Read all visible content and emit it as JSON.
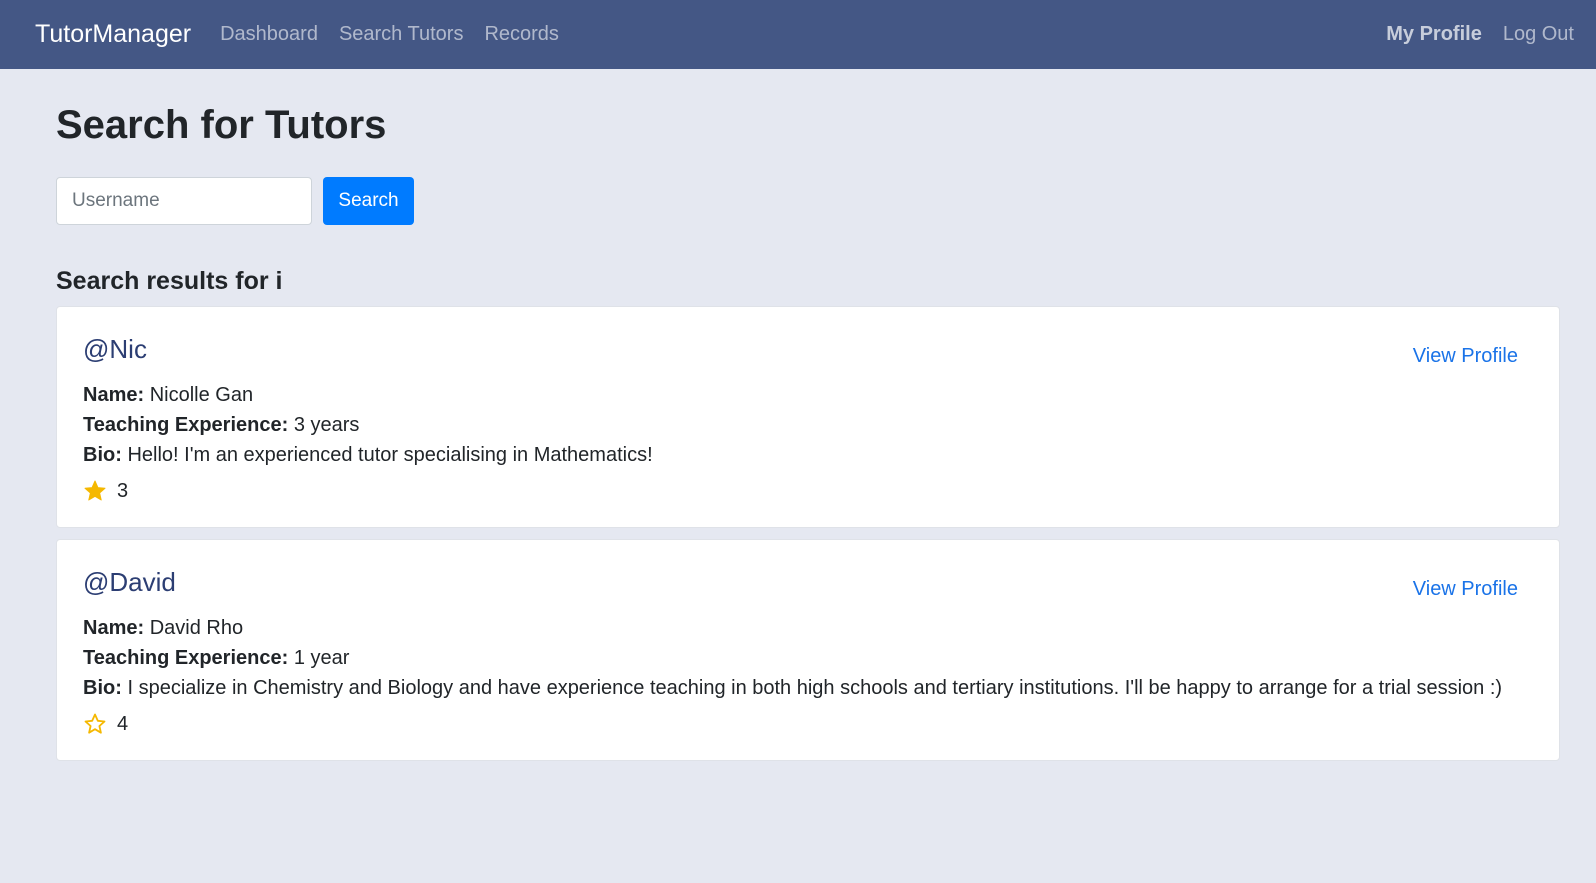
{
  "navbar": {
    "brand": "TutorManager",
    "links": [
      "Dashboard",
      "Search Tutors",
      "Records"
    ],
    "right_links": [
      "My Profile",
      "Log Out"
    ]
  },
  "page": {
    "title": "Search for Tutors"
  },
  "search": {
    "placeholder": "Username",
    "value": "",
    "button_label": "Search"
  },
  "results": {
    "heading_prefix": "Search results for",
    "query": "i",
    "items": [
      {
        "username": "@Nic",
        "name_label": "Name:",
        "name": "Nicolle Gan",
        "experience_label": "Teaching Experience:",
        "experience": "3 years",
        "bio_label": "Bio:",
        "bio": "Hello! I'm an experienced tutor specialising in Mathematics!",
        "rating": "3",
        "star_style": "filled",
        "view_profile": "View Profile"
      },
      {
        "username": "@David",
        "name_label": "Name:",
        "name": "David Rho",
        "experience_label": "Teaching Experience:",
        "experience": "1 year",
        "bio_label": "Bio:",
        "bio": "I specialize in Chemistry and Biology and have experience teaching in both high schools and tertiary institutions. I'll be happy to arrange for a trial session :)",
        "rating": "4",
        "star_style": "outline",
        "view_profile": "View Profile"
      }
    ]
  },
  "colors": {
    "navbar": "#445785",
    "background": "#e5e8f1",
    "primary": "#007bff",
    "star": "#f5b800"
  }
}
